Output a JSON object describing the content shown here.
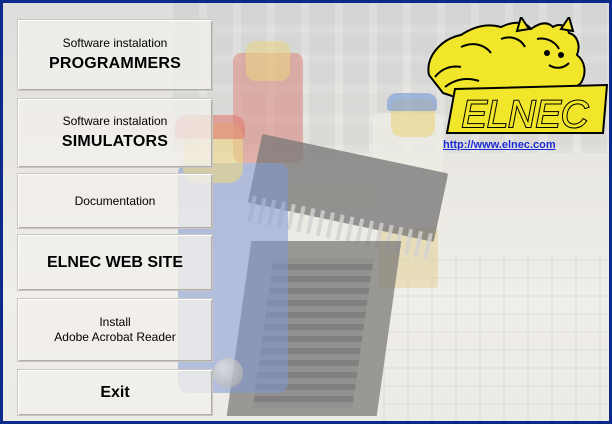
{
  "window": {
    "border_color": "#0c2a8a"
  },
  "menu": {
    "programmers": {
      "line1": "Software instalation",
      "line2": "PROGRAMMERS"
    },
    "simulators": {
      "line1": "Software instalation",
      "line2": "SIMULATORS"
    },
    "documentation": {
      "label": "Documentation"
    },
    "website": {
      "label": "ELNEC WEB SITE"
    },
    "acrobat": {
      "line1": "Install",
      "line2": "Adobe Acrobat Reader"
    },
    "exit": {
      "label": "Exit"
    }
  },
  "logo": {
    "brand": "ELNEC",
    "brand_color": "#f1e62a",
    "cat_color": "#f1e62a"
  },
  "link": {
    "url": "http://www.elnec.com",
    "color": "#1a2bd6"
  }
}
